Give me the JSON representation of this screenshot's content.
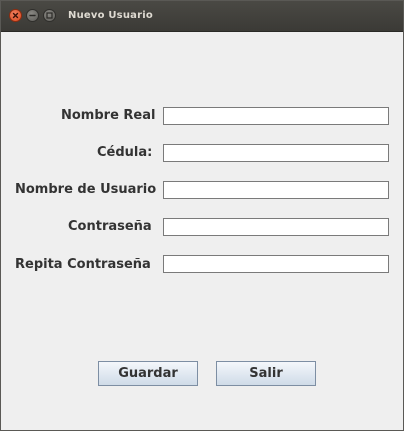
{
  "window": {
    "title": "Nuevo Usuario"
  },
  "form": {
    "fields": [
      {
        "label": "Nombre Real",
        "value": ""
      },
      {
        "label": "Cédula:",
        "value": ""
      },
      {
        "label": "Nombre de Usuario",
        "value": ""
      },
      {
        "label": "Contraseña",
        "value": ""
      },
      {
        "label": "Repita Contraseña",
        "value": ""
      }
    ]
  },
  "buttons": {
    "save_label": "Guardar",
    "exit_label": "Salir"
  },
  "icons": {
    "close": "close-icon",
    "minimize": "minimize-icon",
    "maximize": "maximize-icon"
  },
  "colors": {
    "window_bg": "#efefef",
    "titlebar_bg": "#3c3b37",
    "close_button": "#e05a2b",
    "button_gradient_bottom": "#cfdbe8"
  }
}
